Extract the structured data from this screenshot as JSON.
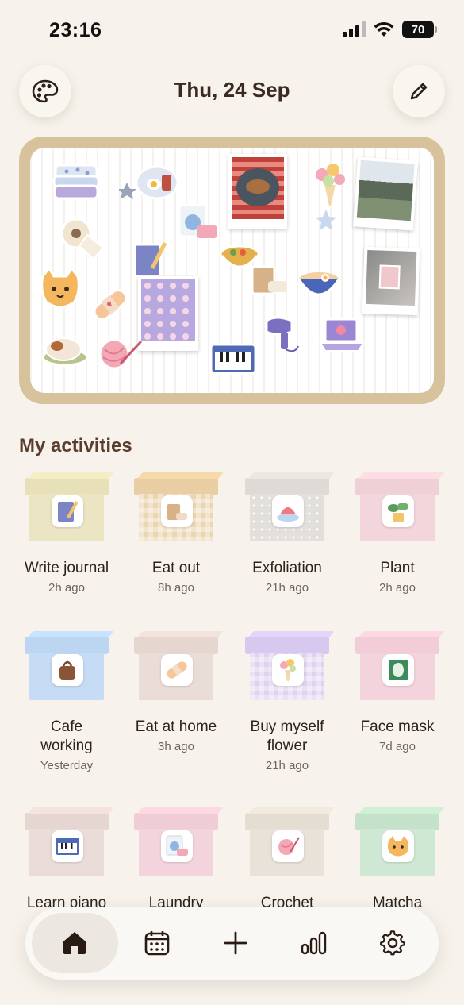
{
  "status": {
    "time": "23:16",
    "battery": "70"
  },
  "header": {
    "date": "Thu, 24 Sep"
  },
  "section": {
    "title": "My activities"
  },
  "activities": [
    {
      "name": "Write journal",
      "time": "2h ago",
      "color": "#e7e0b8",
      "icon": "journal-icon"
    },
    {
      "name": "Eat out",
      "time": "8h ago",
      "color": "#ead4ae",
      "icon": "takeout-bag-icon"
    },
    {
      "name": "Exfoliation",
      "time": "21h ago",
      "color": "#e3e0dc",
      "icon": "sponge-icon"
    },
    {
      "name": "Plant",
      "time": "2h ago",
      "color": "#f2d6dc",
      "icon": "plant-icon"
    },
    {
      "name": "Cafe working",
      "time": "Yesterday",
      "color": "#c6dcf4",
      "icon": "bag-icon"
    },
    {
      "name": "Eat at home",
      "time": "3h ago",
      "color": "#eadcd6",
      "icon": "bandage-icon"
    },
    {
      "name": "Buy myself flower",
      "time": "21h ago",
      "color": "#ddd2f0",
      "icon": "bouquet-icon"
    },
    {
      "name": "Face mask",
      "time": "7d ago",
      "color": "#f4d4dc",
      "icon": "face-mask-icon"
    },
    {
      "name": "Learn piano",
      "time": "",
      "color": "#eadcd8",
      "icon": "piano-icon"
    },
    {
      "name": "Laundry",
      "time": "",
      "color": "#f3d4dc",
      "icon": "washing-machine-icon"
    },
    {
      "name": "Crochet",
      "time": "",
      "color": "#e8e2d8",
      "icon": "yarn-icon"
    },
    {
      "name": "Matcha",
      "time": "",
      "color": "#cfe8d4",
      "icon": "cat-icon"
    }
  ],
  "nav": [
    {
      "name": "home",
      "icon": "home-icon",
      "active": true
    },
    {
      "name": "calendar",
      "icon": "calendar-icon",
      "active": false
    },
    {
      "name": "add",
      "icon": "plus-icon",
      "active": false
    },
    {
      "name": "stats",
      "icon": "bar-chart-icon",
      "active": false
    },
    {
      "name": "settings",
      "icon": "gear-icon",
      "active": false
    }
  ],
  "colors": {
    "background": "#f7f3ec",
    "board_frame": "#d8c29c",
    "text": "#3a2a22"
  }
}
